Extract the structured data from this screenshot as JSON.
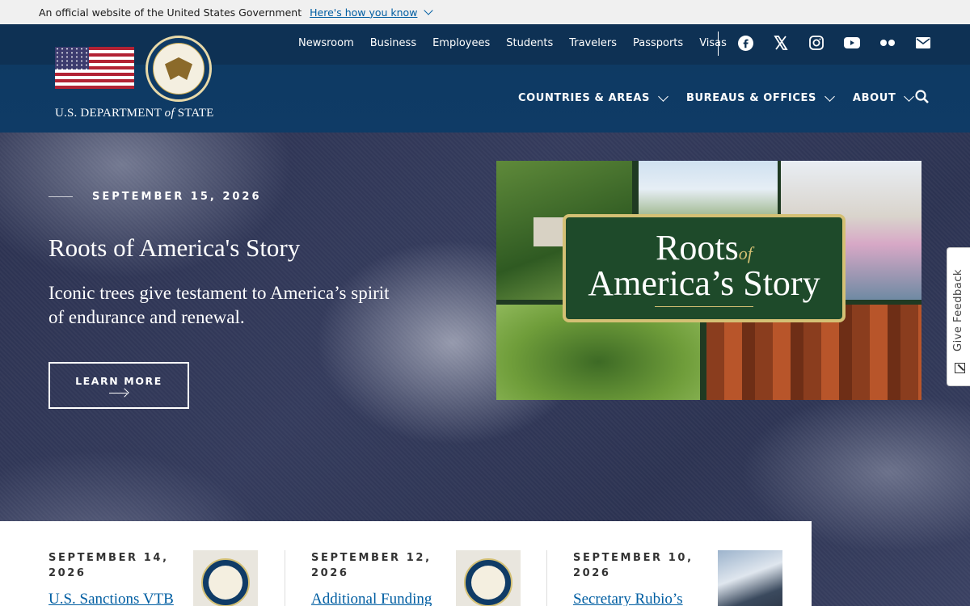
{
  "gov_banner": {
    "text": "An official website of the United States Government",
    "link": "Here's how you know"
  },
  "header": {
    "dept_name_1": "U.S. DEPARTMENT",
    "dept_name_of": "of",
    "dept_name_2": "STATE",
    "utility_nav": [
      "Newsroom",
      "Business",
      "Employees",
      "Students",
      "Travelers",
      "Passports",
      "Visas"
    ],
    "social_icons": [
      "facebook-icon",
      "x-icon",
      "instagram-icon",
      "youtube-icon",
      "flickr-icon",
      "email-icon"
    ],
    "main_nav": [
      "COUNTRIES & AREAS",
      "BUREAUS & OFFICES",
      "ABOUT"
    ]
  },
  "hero": {
    "date": "SEPTEMBER 15, 2026",
    "title": "Roots of America's Story",
    "description": "Iconic trees give testament to America’s spirit of endurance and renewal.",
    "button_label": "LEARN MORE",
    "image_text_1": "Roots",
    "image_text_of": "of",
    "image_text_2": "America’s Story"
  },
  "feedback": {
    "label": "Give Feedback"
  },
  "news": [
    {
      "date": "SEPTEMBER 14, 2026",
      "title": "U.S. Sanctions VTB",
      "thumb": "seal"
    },
    {
      "date": "SEPTEMBER 12, 2026",
      "title": "Additional Funding",
      "thumb": "seal"
    },
    {
      "date": "SEPTEMBER 10, 2026",
      "title": "Secretary Rubio’s",
      "thumb": "photo"
    }
  ]
}
